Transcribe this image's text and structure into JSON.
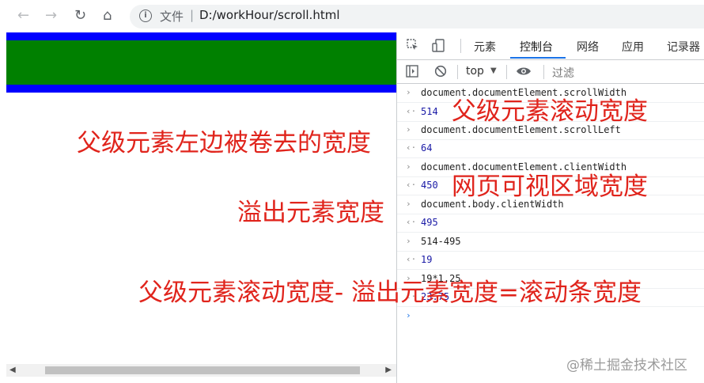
{
  "browser": {
    "nav_back": "←",
    "nav_forward": "→",
    "nav_reload": "↻",
    "nav_home": "⌂",
    "info_icon": "i",
    "scheme_label": "文件",
    "separator": "|",
    "url": "D:/workHour/scroll.html"
  },
  "page": {
    "outer_color": "#0000ff",
    "inner_color": "#008000",
    "scroll_left_arrow": "◀",
    "scroll_right_arrow": "▶"
  },
  "devtools": {
    "tabs": [
      {
        "label": "元素",
        "active": false
      },
      {
        "label": "控制台",
        "active": true
      },
      {
        "label": "网络",
        "active": false
      },
      {
        "label": "应用",
        "active": false
      },
      {
        "label": "记录器",
        "active": false
      }
    ],
    "context": "top",
    "filter_placeholder": "过滤",
    "console": [
      {
        "kind": "input",
        "text": "document.documentElement.scrollWidth"
      },
      {
        "kind": "result",
        "text": "514"
      },
      {
        "kind": "input",
        "text": "document.documentElement.scrollLeft"
      },
      {
        "kind": "result",
        "text": "64"
      },
      {
        "kind": "input",
        "text": "document.documentElement.clientWidth"
      },
      {
        "kind": "result",
        "text": "450"
      },
      {
        "kind": "input",
        "text": "document.body.clientWidth"
      },
      {
        "kind": "result",
        "text": "495"
      },
      {
        "kind": "input",
        "text": "514-495"
      },
      {
        "kind": "result",
        "text": "19"
      },
      {
        "kind": "input",
        "text": "19*1.25"
      },
      {
        "kind": "result",
        "text": "23.75"
      }
    ],
    "prompt_arrow": "›"
  },
  "annotations": {
    "scroll_width": "父级元素滚动宽度",
    "scroll_left": "父级元素左边被卷去的宽度",
    "client_width": "网页可视区域宽度",
    "body_width": "溢出元素宽度",
    "formula": "父级元素滚动宽度- 溢出元素宽度=滚动条宽度",
    "color": "#e0241c"
  },
  "watermark": "@稀土掘金技术社区"
}
